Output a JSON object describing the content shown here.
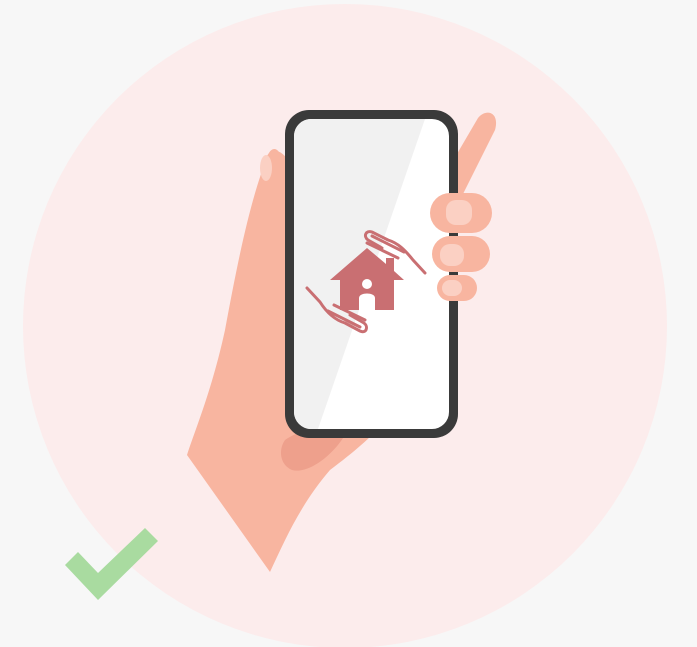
{
  "illustration": {
    "subject": "hand-holding-phone",
    "screen_icon": "house-in-hands-icon",
    "status_icon": "checkmark-icon"
  },
  "colors": {
    "page_background": "#f7f7f7",
    "circle_background": "#fcecec",
    "skin": "#f8b5a0",
    "skin_shadow": "#eea08c",
    "nail": "#fbd0c3",
    "phone_frame": "#3a3a3a",
    "screen": "#ffffff",
    "screen_glare": "#f1f1f1",
    "icon": "#c96f72",
    "checkmark": "#a9dba0"
  }
}
